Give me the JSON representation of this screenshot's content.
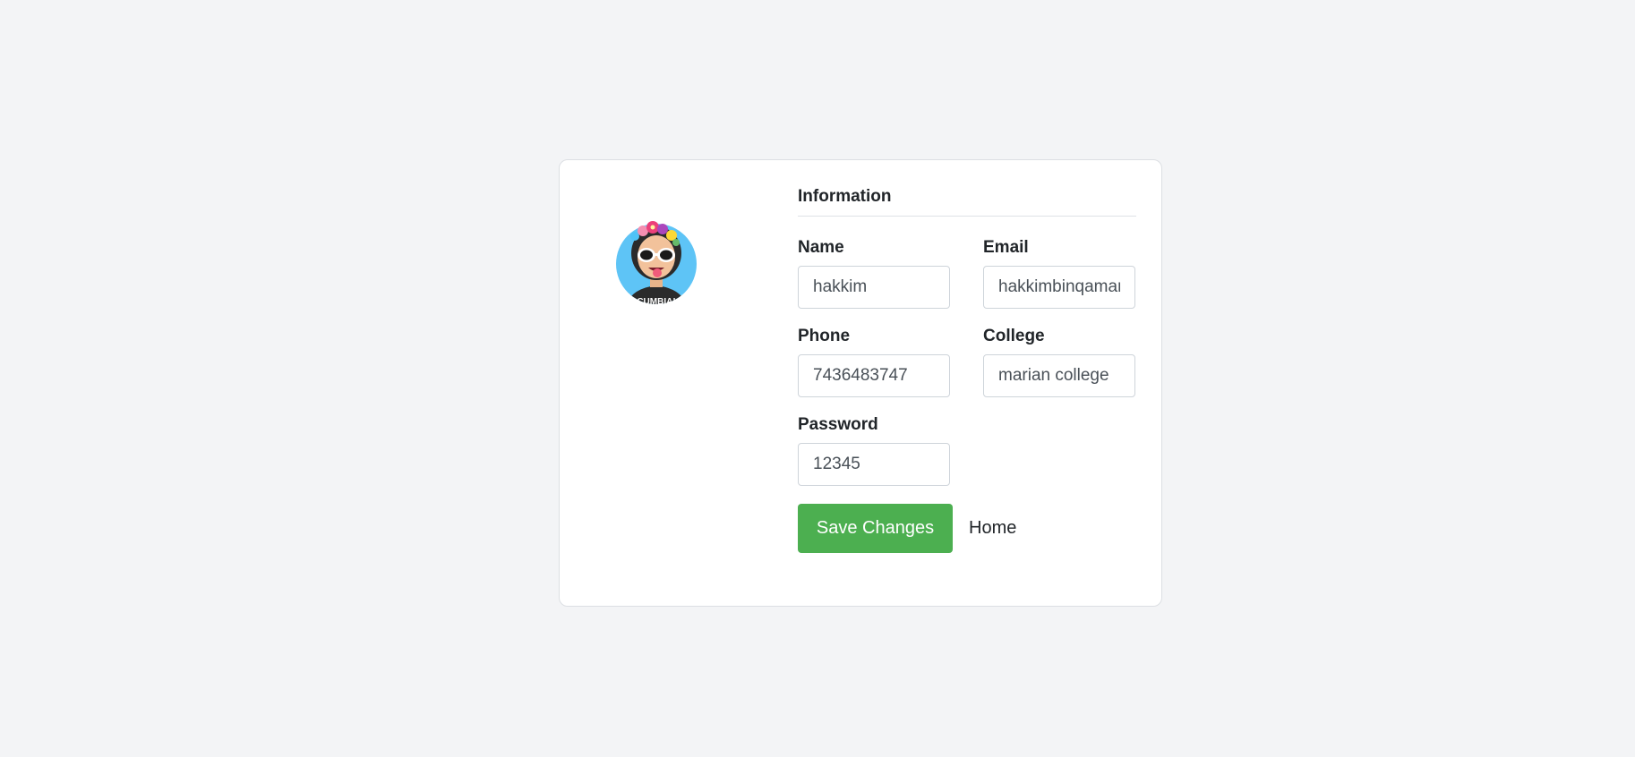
{
  "profile": {
    "avatar_icon": "avatar-illustration",
    "shirt_text": "CUMBIA!"
  },
  "info": {
    "title": "Information"
  },
  "fields": {
    "name": {
      "label": "Name",
      "value": "hakkim"
    },
    "email": {
      "label": "Email",
      "value": "hakkimbinqamar"
    },
    "phone": {
      "label": "Phone",
      "value": "7436483747"
    },
    "college": {
      "label": "College",
      "value": "marian college"
    },
    "password": {
      "label": "Password",
      "value": "12345"
    }
  },
  "actions": {
    "save_label": "Save Changes",
    "home_label": "Home"
  },
  "colors": {
    "background": "#f3f4f6",
    "accent": "#4caf50",
    "avatar_bg": "#5ec4f6"
  }
}
